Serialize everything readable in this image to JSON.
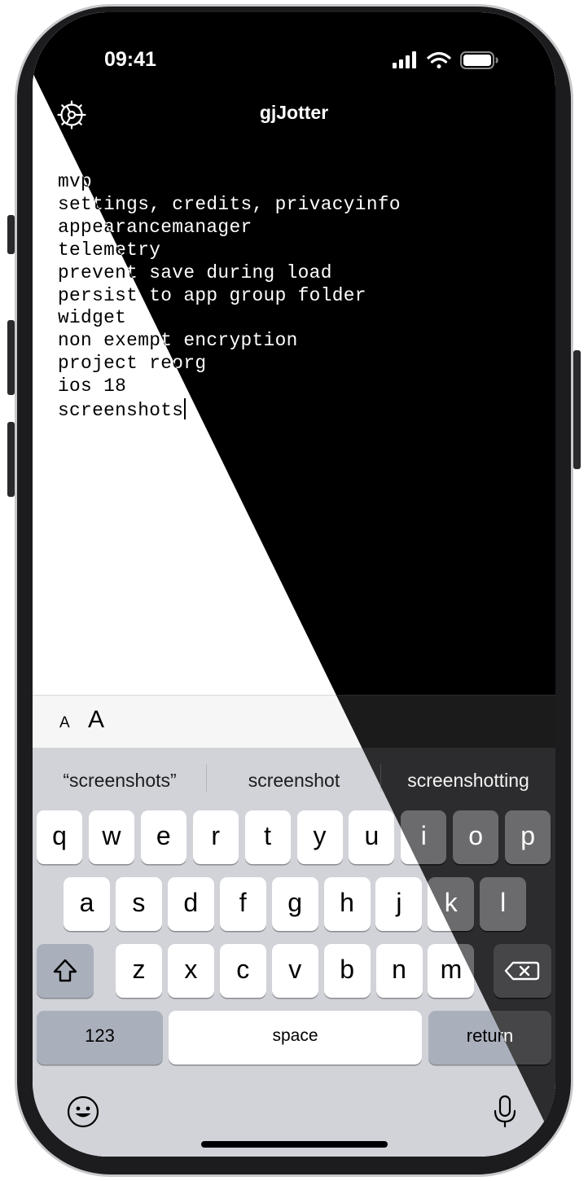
{
  "status_bar": {
    "time": "09:41",
    "icons": [
      "cellular-signal-icon",
      "wifi-icon",
      "battery-icon"
    ]
  },
  "nav": {
    "title": "gjJotter",
    "settings_icon": "gear-icon"
  },
  "note": {
    "lines": [
      "mvp",
      "settings, credits, privacyinfo",
      "appearancemanager",
      "telemetry",
      "prevent save during load",
      "persist to app group folder",
      "widget",
      "non exempt encryption",
      "project reorg",
      "ios 18",
      "screenshots"
    ]
  },
  "format_bar": {
    "font_small": "A",
    "font_large": "A"
  },
  "keyboard": {
    "suggestions": [
      "“screenshots”",
      "screenshot",
      "screenshotting"
    ],
    "row1": [
      "q",
      "w",
      "e",
      "r",
      "t",
      "y",
      "u",
      "i",
      "o",
      "p"
    ],
    "row2": [
      "a",
      "s",
      "d",
      "f",
      "g",
      "h",
      "j",
      "k",
      "l"
    ],
    "row3": [
      "z",
      "x",
      "c",
      "v",
      "b",
      "n",
      "m"
    ],
    "numbers_label": "123",
    "space_label": "space",
    "return_label": "return",
    "shift_icon": "shift-icon",
    "delete_icon": "delete-icon",
    "emoji_icon": "emoji-icon",
    "mic_icon": "microphone-icon"
  },
  "colors": {
    "light_background": "#ffffff",
    "dark_background": "#000000",
    "light_keyboard": "#d1d3d9",
    "dark_keyboard": "#2c2c2e"
  }
}
